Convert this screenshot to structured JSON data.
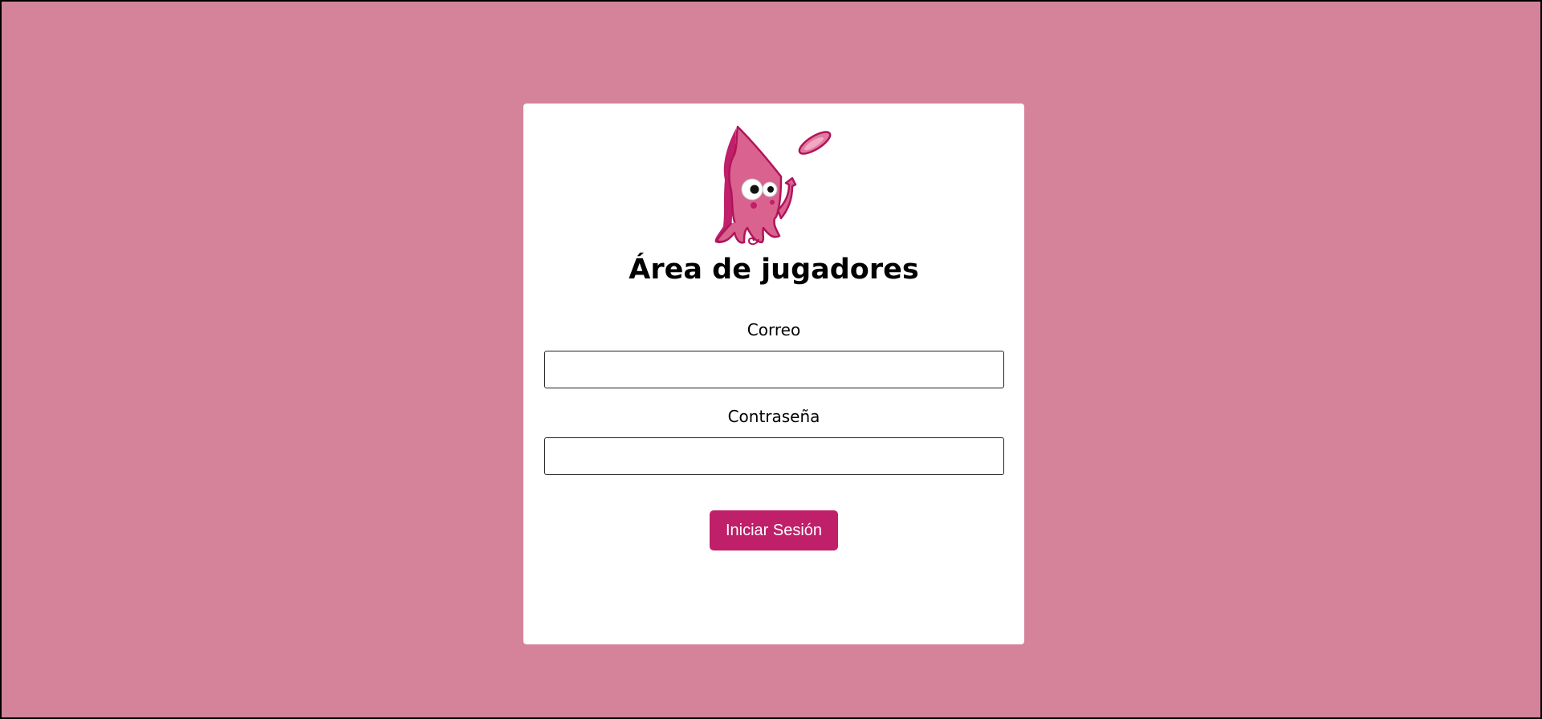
{
  "logo": {
    "icon": "squid-mascot-icon",
    "colors": {
      "body": "#d9628e",
      "outline": "#b0155a",
      "shadow": "#c01f6a"
    }
  },
  "login": {
    "title": "Área de jugadores",
    "email": {
      "label": "Correo",
      "value": "",
      "placeholder": ""
    },
    "password": {
      "label": "Contraseña",
      "value": "",
      "placeholder": ""
    },
    "submit_label": "Iniciar Sesión"
  },
  "colors": {
    "background": "#d4839b",
    "card": "#ffffff",
    "button": "#c01f6a",
    "button_text": "#ffffff"
  }
}
